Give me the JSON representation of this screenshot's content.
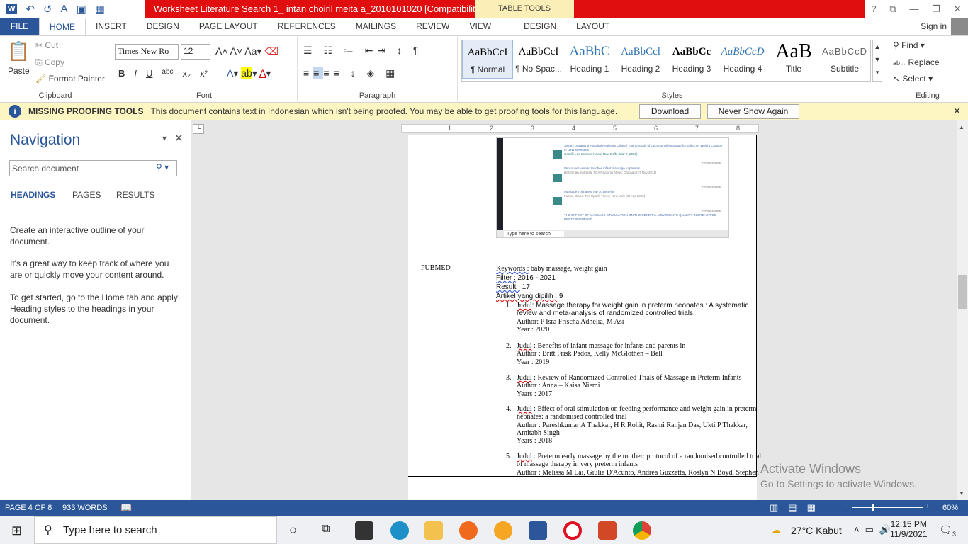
{
  "window": {
    "title": "Worksheet Literature Search 1_ intan choiril meita a_2010101020 [Compatibility M...",
    "context_tab": "TABLE TOOLS",
    "help": "?"
  },
  "tabs": [
    "FILE",
    "HOME",
    "INSERT",
    "DESIGN",
    "PAGE LAYOUT",
    "REFERENCES",
    "MAILINGS",
    "REVIEW",
    "VIEW",
    "DESIGN",
    "LAYOUT"
  ],
  "account": {
    "signin": "Sign in"
  },
  "ribbon": {
    "clipboard": {
      "paste": "Paste",
      "cut": "Cut",
      "copy": "Copy",
      "format_painter": "Format Painter",
      "label": "Clipboard"
    },
    "font": {
      "name": "Times New Ro",
      "size": "12",
      "label": "Font",
      "buttons": [
        "B",
        "I",
        "U",
        "abc",
        "x₂",
        "x²"
      ]
    },
    "paragraph": {
      "label": "Paragraph"
    },
    "styles": {
      "label": "Styles",
      "items": [
        {
          "preview": "AaBbCcI",
          "name": "¶ Normal"
        },
        {
          "preview": "AaBbCcI",
          "name": "¶ No Spac..."
        },
        {
          "preview": "AaBbC",
          "name": "Heading 1"
        },
        {
          "preview": "AaBbCcl",
          "name": "Heading 2"
        },
        {
          "preview": "AaBbCc",
          "name": "Heading 3"
        },
        {
          "preview": "AaBbCcD",
          "name": "Heading 4"
        },
        {
          "preview": "AaB",
          "name": "Title"
        },
        {
          "preview": "AaBbCcD",
          "name": "Subtitle"
        }
      ]
    },
    "editing": {
      "find": "Find",
      "replace": "Replace",
      "select": "Select",
      "label": "Editing"
    }
  },
  "message_bar": {
    "title": "MISSING PROOFING TOOLS",
    "text": "This document contains text in Indonesian which isn't being proofed. You may be able to get proofing tools for this language.",
    "download": "Download",
    "never": "Never Show Again"
  },
  "navigation": {
    "title": "Navigation",
    "search_placeholder": "Search document",
    "tabs": [
      "HEADINGS",
      "PAGES",
      "RESULTS"
    ],
    "p1": "Create an interactive outline of your document.",
    "p2": "It's a great way to keep track of where you are or quickly move your content around.",
    "p3": "To get started, go to the Home tab and apply Heading styles to the headings in your document."
  },
  "ruler": [
    "1",
    "2",
    "3",
    "4",
    "5",
    "6",
    "7",
    "8"
  ],
  "document": {
    "source": "PUBMED",
    "keywords_label": "Keywords :",
    "keywords": " baby massage, weight gain",
    "filter_label": "Filter :",
    "filter": " 2016 - 2021",
    "result_label": "Result :",
    "result": " 17",
    "artikel_label": "Artikel yang dipilih :",
    "artikel": " 9",
    "items": [
      {
        "n": "1.",
        "judul": "Judul",
        "title": ":  Massage therapy for weight gain in preterm neonates : A systematic",
        "title2": "review and meta-analysis of randomized controlled trials.",
        "author": "Author: P Isra Frischa Adhelia, M Asi",
        "year": "Year : 2020"
      },
      {
        "n": "2.",
        "judul": "Judul",
        "title": " : Benefits  of infant massage for infants and parents in",
        "author": "Author : Britt Frisk Pados, Kelly McGlothen – Bell",
        "year": "Year : 2019"
      },
      {
        "n": "3.",
        "judul": "Judul",
        "title": " : Review of Randomized Controlled Trials of Massage in Preterm Infants",
        "author": "Author : Anna – Kaisa Niemi",
        "year": "Years : 2017"
      },
      {
        "n": "4.",
        "judul": "Judul",
        "title": " : Effect of oral stimulation on feeding performance and weight gain in preterm",
        "title2": "neonates: a randomised controlled trial",
        "author": "Author : Pareshkumar A Thakkar, H R Rohit, Rasmi Ranjan Das, Ukti P Thakkar,",
        "author2": "Amitabh Singh",
        "year": "Years : 2018"
      },
      {
        "n": "5.",
        "judul": "Judul",
        "title": " : Preterm early massage by the mother: protocol of a randomised controlled trial",
        "title2": "of massage therapy in very preterm infants",
        "author": "Author : Melissa M Lai, Giulia D'Acunto, Andrea Guzzetta, Roslyn N Boyd, Stephen"
      }
    ],
    "embedded": {
      "results": [
        {
          "title": "Swami Dayanand Hospital Registers Clinical Trial to Study of Coconut Oil Massage for Effect on Weight Change in LBW Neonates",
          "meta": "Contify Life Science News; New Delhi (Mar 7, 2020)",
          "badge": "Preview available"
        },
        {
          "title": "Vancouver woman teaches infant massage to parents",
          "meta": "Hershman, Marissa. TCA Regional News; Chicago (27 Nov 2011)",
          "badge": "Preview available"
        },
        {
          "title": "Massage Therapy's Top 10 Benefits",
          "meta": "Fulton, Diane. The Epoch Times; New York (09 Apr 2020)",
          "badge": "Preview available"
        },
        {
          "title": "THE EFFECT OF MASSAGE STIMULATION ON THE GENERAL MOVEMENTS QUALITY IN BREASTFED PRETERM INFANT",
          "meta": "",
          "badge": "Preview available"
        }
      ],
      "search": "Type here to search"
    }
  },
  "status": {
    "page": "PAGE 4 OF 8",
    "words": "933 WORDS",
    "zoom": "60%",
    "zoom_percent": 60
  },
  "watermark": {
    "line1": "Activate Windows",
    "line2": "Go to Settings to activate Windows."
  },
  "taskbar": {
    "search": "Type here to search",
    "weather": "27°C  Kabut",
    "time": "12:15 PM",
    "date": "11/9/2021",
    "notifications": "3"
  },
  "colors": {
    "accent": "#2b579a",
    "title_red": "#e00e0e",
    "message_bar": "#fdf6c3"
  }
}
